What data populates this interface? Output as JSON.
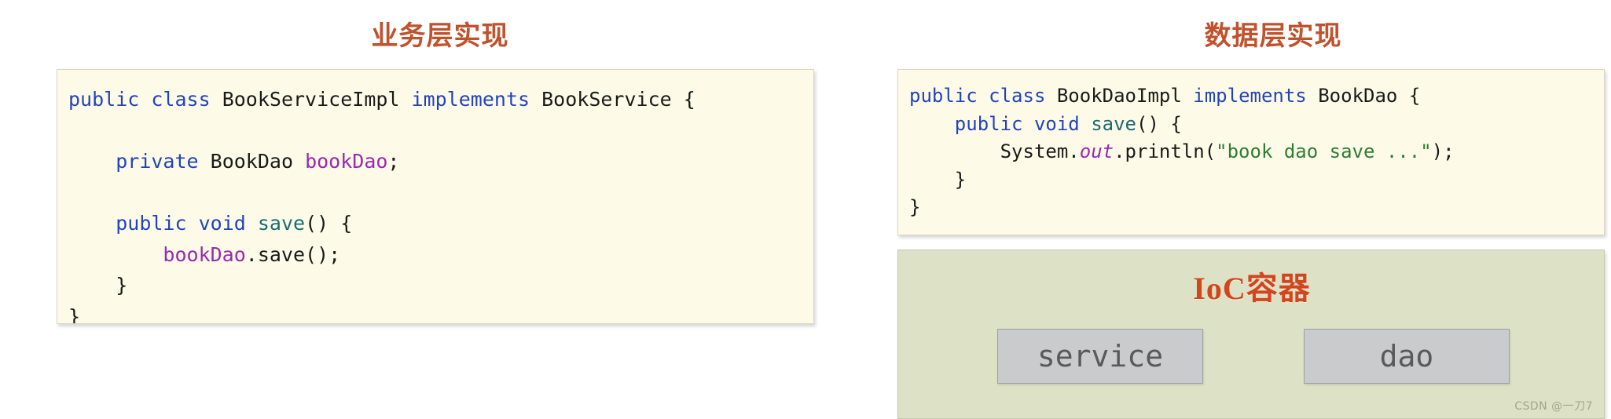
{
  "columns": {
    "left_title": "业务层实现",
    "right_title": "数据层实现"
  },
  "colors": {
    "title_accent": "#c0522d",
    "ioc_title_accent": "#d2461e",
    "code_background": "#fdfbe8",
    "ioc_background": "#dde2c6",
    "bean_background": "#c9cbcd",
    "keyword": "#2244bb",
    "field": "#9c27b0",
    "method": "#1b6b74",
    "string": "#2e7d32"
  },
  "service_code": {
    "lines": [
      "public class BookServiceImpl implements BookService {",
      "",
      "    private BookDao bookDao;",
      "",
      "    public void save() {",
      "        bookDao.save();",
      "    }",
      "}"
    ]
  },
  "dao_code": {
    "lines": [
      "public class BookDaoImpl implements BookDao {",
      "    public void save() {",
      "        System.out.println(\"book dao save ...\");",
      "    }",
      "}"
    ]
  },
  "ioc": {
    "title": "IoC容器",
    "beans": [
      {
        "label": "service"
      },
      {
        "label": "dao"
      }
    ]
  },
  "watermark": {
    "text": "CSDN @一刀7"
  }
}
